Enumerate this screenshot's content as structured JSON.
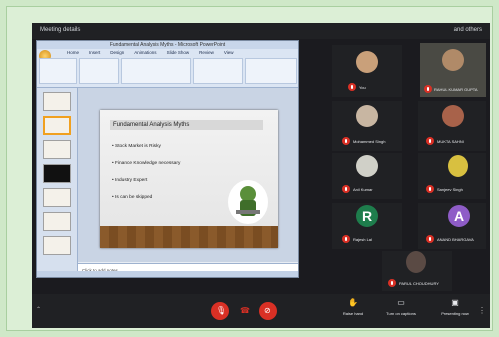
{
  "window": {
    "title": "Fundamental Analysis Myths - Microsoft PowerPoint",
    "meeting_left": "Meeting details",
    "meeting_right": "and others"
  },
  "ppt": {
    "tabs": [
      "Home",
      "Insert",
      "Design",
      "Animations",
      "Slide Show",
      "Review",
      "View"
    ],
    "slide_title": "Fundamental Analysis Myths",
    "bullets": [
      "Stock Market is Risky",
      "Finance Knowledge necessary",
      "Industry Expert",
      "Is can be skipped"
    ],
    "notes_placeholder": "Click to add notes"
  },
  "participants": [
    {
      "name": "You",
      "color": "#d93025"
    },
    {
      "name": "RAHUL KUMAR GUPTA",
      "color": "#d93025"
    },
    {
      "name": "Mohammed Singh",
      "color": "#d93025"
    },
    {
      "name": "MUKTA SAHNI",
      "color": "#d93025"
    },
    {
      "name": "Anil Kumar",
      "color": "#d93025"
    },
    {
      "name": "Sanjeev Singh",
      "color": "#d93025"
    },
    {
      "name": "Rajesh Lal",
      "letter": "R",
      "letter_color": "#1e7d4c"
    },
    {
      "name": "ANAND BHARGAVA",
      "letter": "A",
      "letter_color": "#8e5cc7"
    },
    {
      "name": "PARUL CHOUDHURY"
    }
  ],
  "controls": {
    "raise_hand": "Raise hand",
    "turn_on_captions": "Turn on captions",
    "present": "Presenting now"
  },
  "colors": {
    "accent_red": "#d93025",
    "bg": "#202124"
  }
}
